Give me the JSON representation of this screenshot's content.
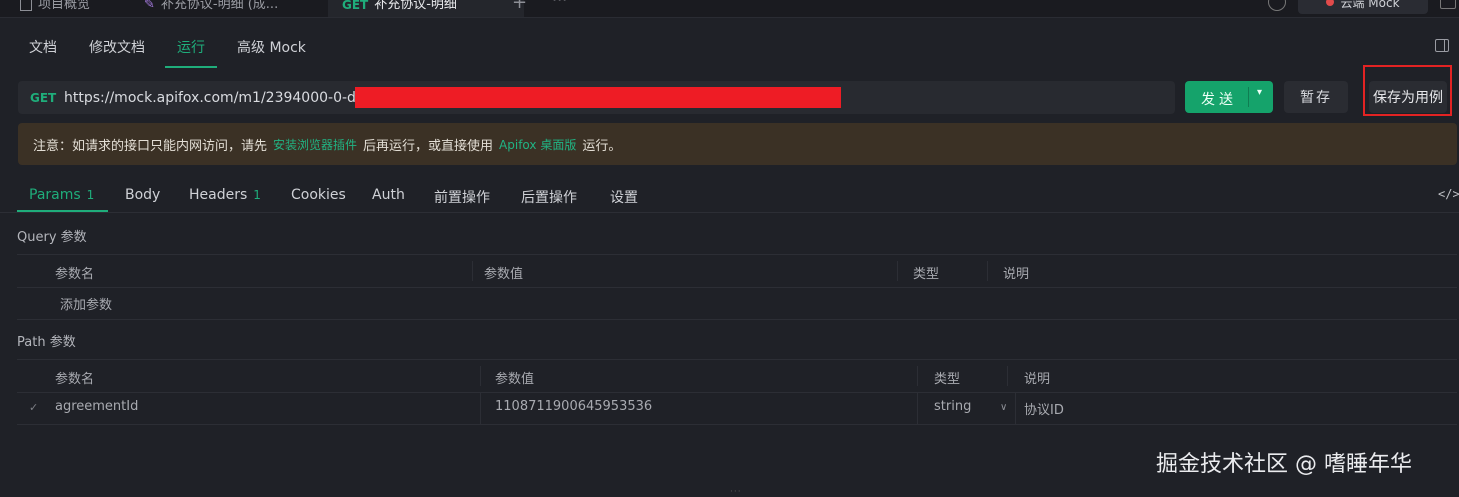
{
  "top_tabs": {
    "overview": "项目概览",
    "tab2": "补充协议-明细 (成...",
    "active_method": "GET",
    "active_label": "补充协议-明细",
    "cloud_mock": "云端 Mock"
  },
  "sub_tabs": [
    "文档",
    "修改文档",
    "运行",
    "高级 Mock"
  ],
  "request": {
    "method": "GET",
    "url": "https://mock.apifox.com/m1/2394000-0-default",
    "send_label": "发送",
    "save_temp_label": "暂存",
    "save_case_label": "保存为用例"
  },
  "notice": {
    "prefix": "注意：如请求的接口只能内网访问，请先",
    "link1": "安装浏览器插件",
    "middle": "后再运行，或直接使用",
    "link2": "Apifox 桌面版",
    "suffix": "运行。"
  },
  "param_tabs": [
    {
      "label": "Params",
      "count": "1"
    },
    {
      "label": "Body",
      "count": ""
    },
    {
      "label": "Headers",
      "count": "1"
    },
    {
      "label": "Cookies",
      "count": ""
    },
    {
      "label": "Auth",
      "count": ""
    },
    {
      "label": "前置操作",
      "count": ""
    },
    {
      "label": "后置操作",
      "count": ""
    },
    {
      "label": "设置",
      "count": ""
    }
  ],
  "query": {
    "title": "Query 参数",
    "headers": [
      "参数名",
      "参数值",
      "类型",
      "说明"
    ],
    "add_placeholder": "添加参数"
  },
  "path": {
    "title": "Path 参数",
    "headers": [
      "参数名",
      "参数值",
      "类型",
      "说明"
    ],
    "rows": [
      {
        "name": "agreementId",
        "value": "1108711900645953536",
        "type": "string",
        "desc": "协议ID"
      }
    ]
  },
  "watermark": "掘金技术社区 @ 嗜睡年华",
  "colors": {
    "accent": "#1fad7b",
    "highlight_box": "#e32323",
    "redaction": "#ee1c25"
  }
}
